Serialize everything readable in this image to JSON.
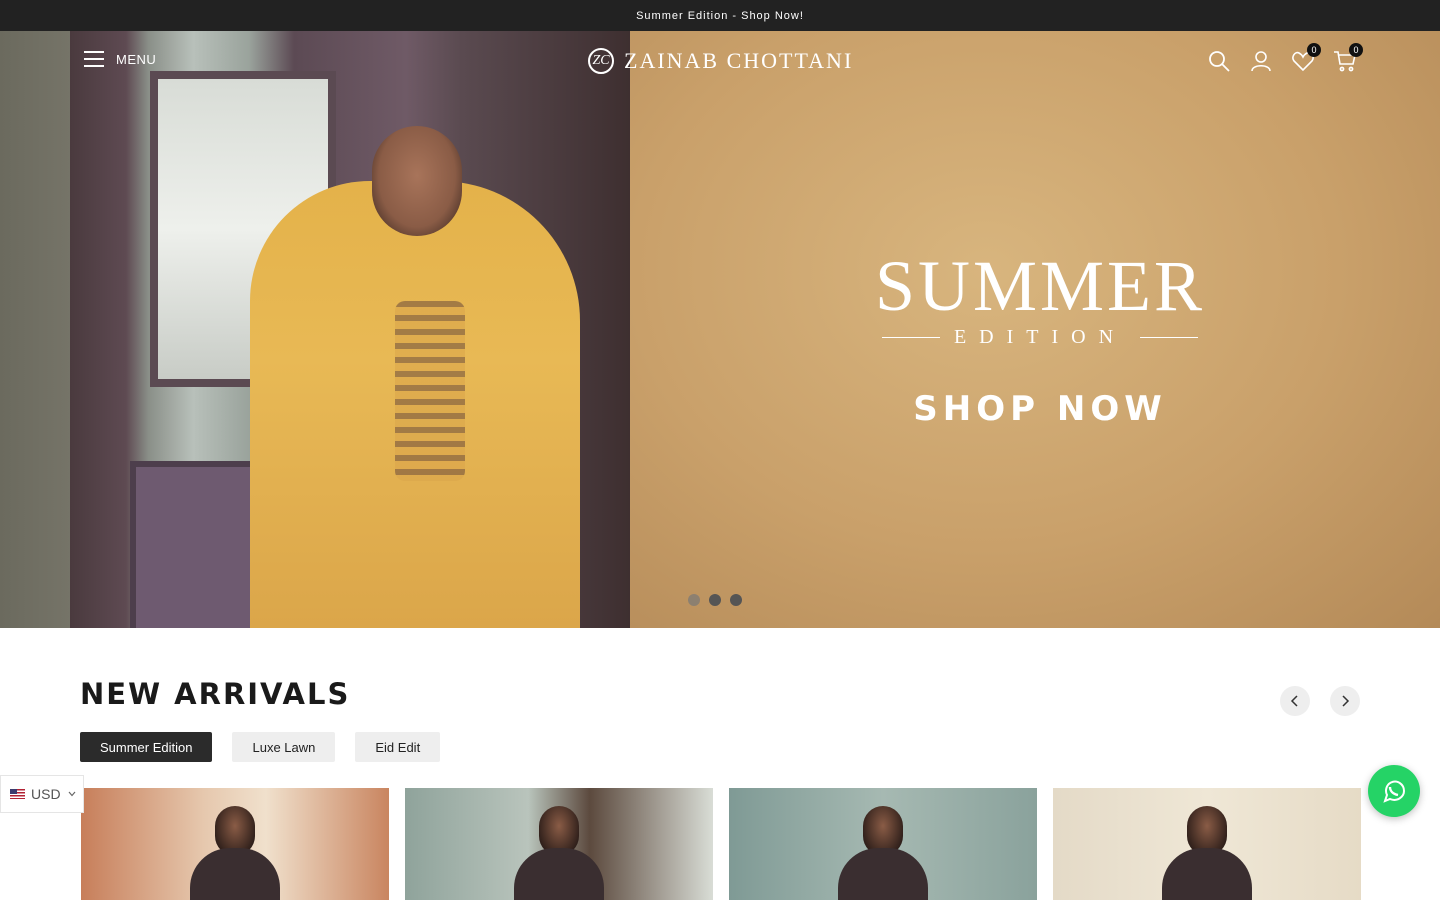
{
  "announcement": "Summer Edition - Shop Now!",
  "header": {
    "menu_label": "MENU",
    "logo_mark": "ZC",
    "brand": "ZAINAB CHOTTANI",
    "wishlist_count": "0",
    "cart_count": "0",
    "icons": [
      "search-icon",
      "account-icon",
      "heart-icon",
      "cart-icon"
    ]
  },
  "hero": {
    "title": "SUMMER",
    "subtitle": "EDITION",
    "cta": "SHOP NOW",
    "slides": 3
  },
  "new_arrivals": {
    "title": "NEW ARRIVALS",
    "tabs": [
      {
        "label": "Summer Edition",
        "active": true
      },
      {
        "label": "Luxe Lawn",
        "active": false
      },
      {
        "label": "Eid Edit",
        "active": false
      }
    ],
    "products_visible": 4
  },
  "currency": {
    "code": "USD"
  },
  "colors": {
    "announcement_bg": "#222222",
    "active_tab_bg": "#2b2b2b",
    "whatsapp": "#25d366"
  }
}
